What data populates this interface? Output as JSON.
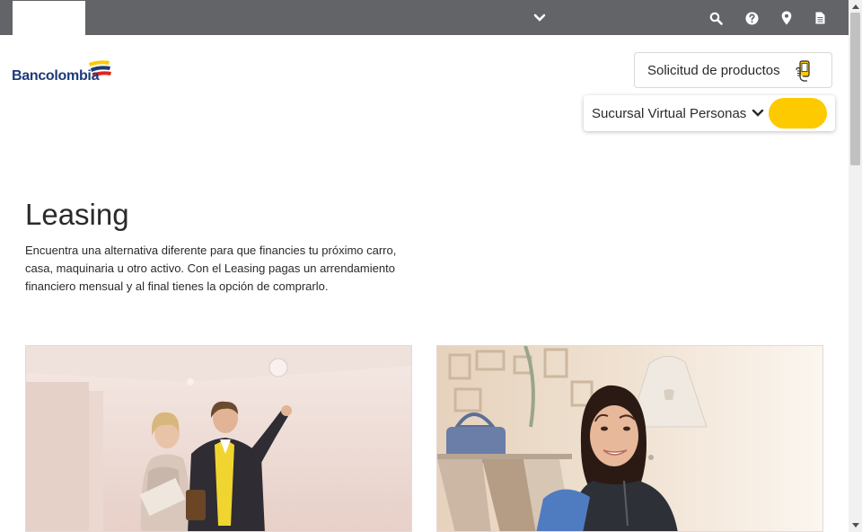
{
  "topbar": {
    "icons": [
      "chevron-down-icon",
      "search-icon",
      "help-icon",
      "location-pin-icon",
      "document-icon"
    ]
  },
  "header": {
    "logo_text": "Bancolombia",
    "products_button": "Solicitud de productos",
    "sucursal_label": "Sucursal Virtual Personas"
  },
  "main": {
    "title": "Leasing",
    "description": "Encuentra una alternativa diferente para que financies tu próximo carro, casa, maquinaria u otro activo. Con el Leasing pagas un arrendamiento financiero mensual y al final tienes la opción de comprarlo."
  },
  "colors": {
    "topbar": "#636468",
    "brand_yellow": "#fdca00",
    "brand_blue": "#1d3a78",
    "brand_red": "#e1251b"
  }
}
